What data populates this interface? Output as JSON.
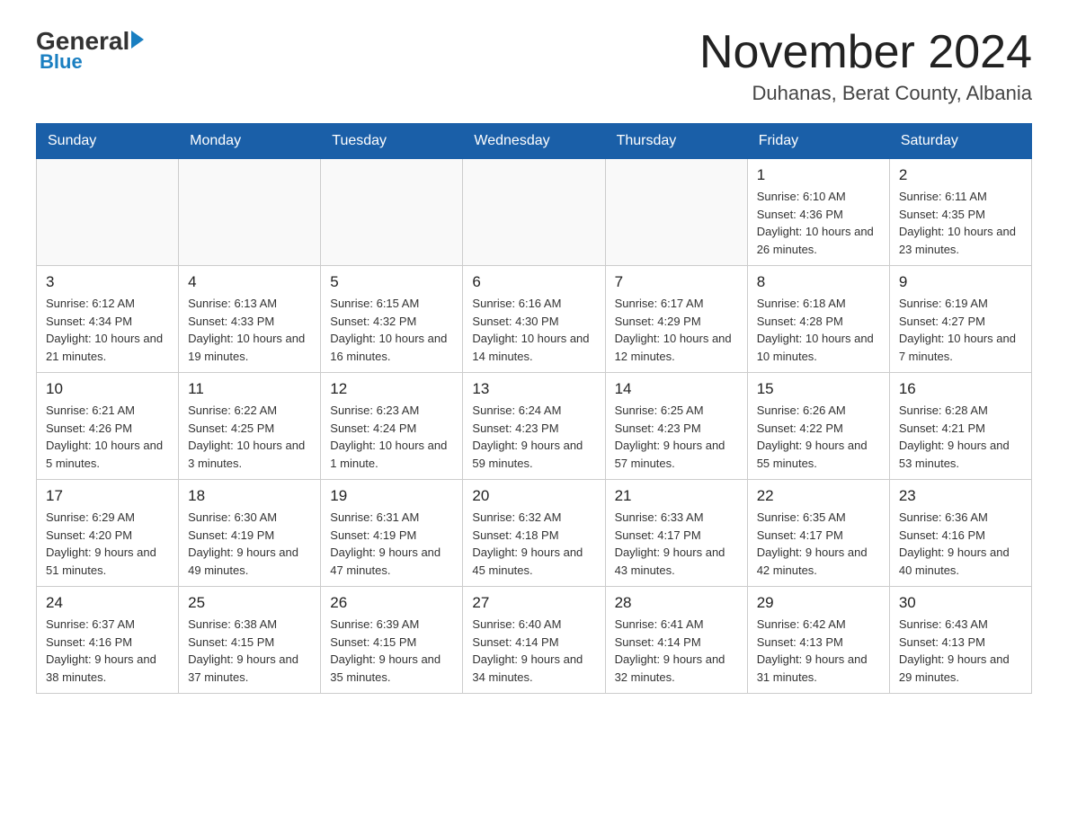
{
  "logo": {
    "general": "General",
    "blue": "Blue",
    "arrow_color": "#1a7fc1"
  },
  "header": {
    "title": "November 2024",
    "location": "Duhanas, Berat County, Albania"
  },
  "weekdays": [
    "Sunday",
    "Monday",
    "Tuesday",
    "Wednesday",
    "Thursday",
    "Friday",
    "Saturday"
  ],
  "weeks": [
    [
      {
        "day": "",
        "info": ""
      },
      {
        "day": "",
        "info": ""
      },
      {
        "day": "",
        "info": ""
      },
      {
        "day": "",
        "info": ""
      },
      {
        "day": "",
        "info": ""
      },
      {
        "day": "1",
        "info": "Sunrise: 6:10 AM\nSunset: 4:36 PM\nDaylight: 10 hours and 26 minutes."
      },
      {
        "day": "2",
        "info": "Sunrise: 6:11 AM\nSunset: 4:35 PM\nDaylight: 10 hours and 23 minutes."
      }
    ],
    [
      {
        "day": "3",
        "info": "Sunrise: 6:12 AM\nSunset: 4:34 PM\nDaylight: 10 hours and 21 minutes."
      },
      {
        "day": "4",
        "info": "Sunrise: 6:13 AM\nSunset: 4:33 PM\nDaylight: 10 hours and 19 minutes."
      },
      {
        "day": "5",
        "info": "Sunrise: 6:15 AM\nSunset: 4:32 PM\nDaylight: 10 hours and 16 minutes."
      },
      {
        "day": "6",
        "info": "Sunrise: 6:16 AM\nSunset: 4:30 PM\nDaylight: 10 hours and 14 minutes."
      },
      {
        "day": "7",
        "info": "Sunrise: 6:17 AM\nSunset: 4:29 PM\nDaylight: 10 hours and 12 minutes."
      },
      {
        "day": "8",
        "info": "Sunrise: 6:18 AM\nSunset: 4:28 PM\nDaylight: 10 hours and 10 minutes."
      },
      {
        "day": "9",
        "info": "Sunrise: 6:19 AM\nSunset: 4:27 PM\nDaylight: 10 hours and 7 minutes."
      }
    ],
    [
      {
        "day": "10",
        "info": "Sunrise: 6:21 AM\nSunset: 4:26 PM\nDaylight: 10 hours and 5 minutes."
      },
      {
        "day": "11",
        "info": "Sunrise: 6:22 AM\nSunset: 4:25 PM\nDaylight: 10 hours and 3 minutes."
      },
      {
        "day": "12",
        "info": "Sunrise: 6:23 AM\nSunset: 4:24 PM\nDaylight: 10 hours and 1 minute."
      },
      {
        "day": "13",
        "info": "Sunrise: 6:24 AM\nSunset: 4:23 PM\nDaylight: 9 hours and 59 minutes."
      },
      {
        "day": "14",
        "info": "Sunrise: 6:25 AM\nSunset: 4:23 PM\nDaylight: 9 hours and 57 minutes."
      },
      {
        "day": "15",
        "info": "Sunrise: 6:26 AM\nSunset: 4:22 PM\nDaylight: 9 hours and 55 minutes."
      },
      {
        "day": "16",
        "info": "Sunrise: 6:28 AM\nSunset: 4:21 PM\nDaylight: 9 hours and 53 minutes."
      }
    ],
    [
      {
        "day": "17",
        "info": "Sunrise: 6:29 AM\nSunset: 4:20 PM\nDaylight: 9 hours and 51 minutes."
      },
      {
        "day": "18",
        "info": "Sunrise: 6:30 AM\nSunset: 4:19 PM\nDaylight: 9 hours and 49 minutes."
      },
      {
        "day": "19",
        "info": "Sunrise: 6:31 AM\nSunset: 4:19 PM\nDaylight: 9 hours and 47 minutes."
      },
      {
        "day": "20",
        "info": "Sunrise: 6:32 AM\nSunset: 4:18 PM\nDaylight: 9 hours and 45 minutes."
      },
      {
        "day": "21",
        "info": "Sunrise: 6:33 AM\nSunset: 4:17 PM\nDaylight: 9 hours and 43 minutes."
      },
      {
        "day": "22",
        "info": "Sunrise: 6:35 AM\nSunset: 4:17 PM\nDaylight: 9 hours and 42 minutes."
      },
      {
        "day": "23",
        "info": "Sunrise: 6:36 AM\nSunset: 4:16 PM\nDaylight: 9 hours and 40 minutes."
      }
    ],
    [
      {
        "day": "24",
        "info": "Sunrise: 6:37 AM\nSunset: 4:16 PM\nDaylight: 9 hours and 38 minutes."
      },
      {
        "day": "25",
        "info": "Sunrise: 6:38 AM\nSunset: 4:15 PM\nDaylight: 9 hours and 37 minutes."
      },
      {
        "day": "26",
        "info": "Sunrise: 6:39 AM\nSunset: 4:15 PM\nDaylight: 9 hours and 35 minutes."
      },
      {
        "day": "27",
        "info": "Sunrise: 6:40 AM\nSunset: 4:14 PM\nDaylight: 9 hours and 34 minutes."
      },
      {
        "day": "28",
        "info": "Sunrise: 6:41 AM\nSunset: 4:14 PM\nDaylight: 9 hours and 32 minutes."
      },
      {
        "day": "29",
        "info": "Sunrise: 6:42 AM\nSunset: 4:13 PM\nDaylight: 9 hours and 31 minutes."
      },
      {
        "day": "30",
        "info": "Sunrise: 6:43 AM\nSunset: 4:13 PM\nDaylight: 9 hours and 29 minutes."
      }
    ]
  ]
}
